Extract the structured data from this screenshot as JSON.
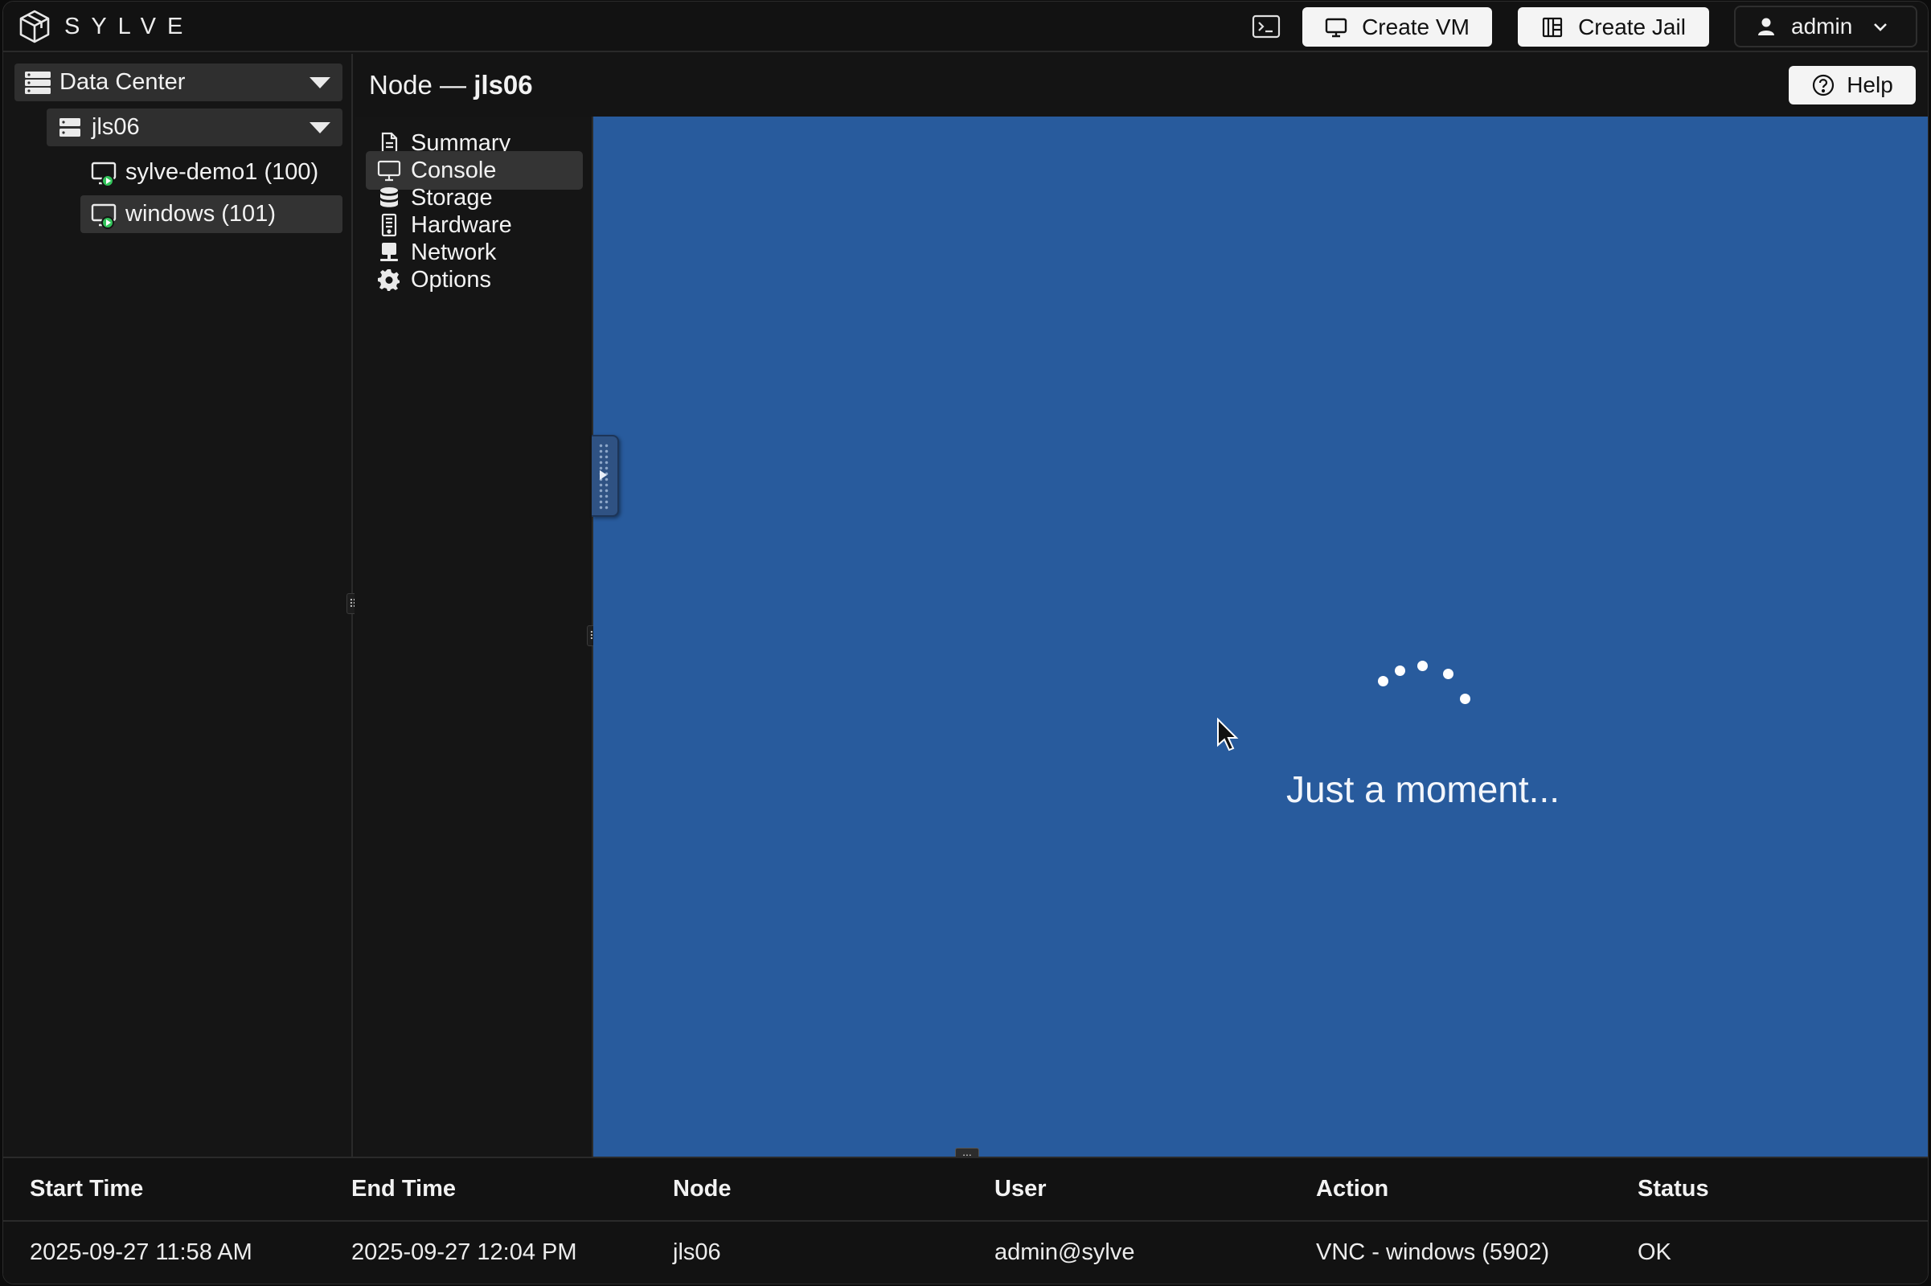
{
  "app": {
    "brand": "SYLVE",
    "create_vm_label": "Create VM",
    "create_jail_label": "Create Jail",
    "user_label": "admin"
  },
  "tree": {
    "datacenter_label": "Data Center",
    "node_label": "jls06",
    "vms": [
      {
        "label": "sylve-demo1 (100)",
        "status": "running"
      },
      {
        "label": "windows (101)",
        "status": "running"
      }
    ]
  },
  "node_header": {
    "prefix": "Node —",
    "name": "jls06",
    "help_label": "Help"
  },
  "menu": {
    "items": [
      {
        "label": "Summary",
        "icon": "file-icon"
      },
      {
        "label": "Console",
        "icon": "monitor-icon"
      },
      {
        "label": "Storage",
        "icon": "database-icon"
      },
      {
        "label": "Hardware",
        "icon": "hardware-icon"
      },
      {
        "label": "Network",
        "icon": "network-icon"
      },
      {
        "label": "Options",
        "icon": "gear-icon"
      }
    ],
    "active": "Console"
  },
  "console": {
    "message": "Just a moment...",
    "background": "#285b9d"
  },
  "tasks": {
    "columns": [
      "Start Time",
      "End Time",
      "Node",
      "User",
      "Action",
      "Status"
    ],
    "rows": [
      [
        "2025-09-27 11:58 AM",
        "2025-09-27 12:04 PM",
        "jls06",
        "admin@sylve",
        "VNC - windows (5902)",
        "OK"
      ]
    ]
  }
}
